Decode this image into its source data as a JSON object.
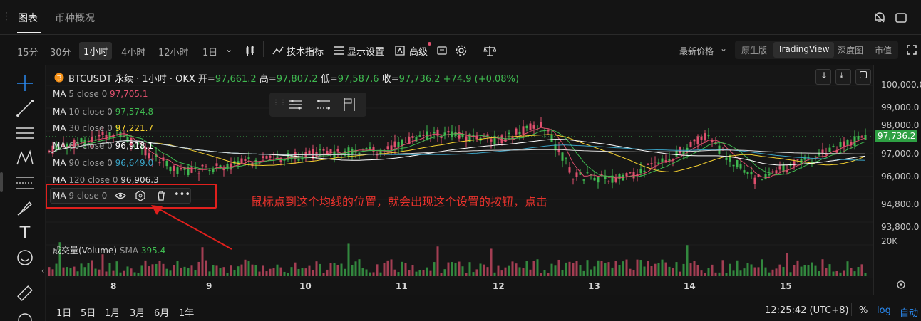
{
  "tabs": [
    {
      "label": "图表"
    },
    {
      "label": "币种概况"
    }
  ],
  "toolbar": {
    "timeframes": [
      "15分",
      "30分",
      "1小时",
      "4小时",
      "12小时",
      "1日"
    ],
    "active_timeframe": "1小时",
    "indicators_label": "技术指标",
    "display_label": "显示设置",
    "advanced_label": "高级",
    "price_type_label": "最新价格",
    "views": [
      "原生版",
      "TradingView",
      "深度图",
      "市值"
    ],
    "active_view": "TradingView"
  },
  "symbol": {
    "title": "BTCUSDT 永续 · 1小时 · OKX",
    "open_label": "开=",
    "open": "97,661.2",
    "high_label": "高=",
    "high": "97,807.2",
    "low_label": "低=",
    "low": "97,587.6",
    "close_label": "收=",
    "close": "97,736.2",
    "change": "+74.9 (+0.08%)"
  },
  "ma": [
    {
      "label": "MA",
      "params": "5 close 0",
      "value": "97,705.1",
      "color": "#e0506e"
    },
    {
      "label": "MA",
      "params": "10 close 0",
      "value": "97,574.8",
      "color": "#3fb950"
    },
    {
      "label": "MA",
      "params": "30 close 0",
      "value": "97,221.7",
      "color": "#f5d130"
    },
    {
      "label": "MA",
      "params": "60 close 0",
      "value": "96,918.1",
      "color": "#ffffff"
    },
    {
      "label": "MA",
      "params": "90 close 0",
      "value": "96,649.0",
      "color": "#3aa3c6"
    },
    {
      "label": "MA",
      "params": "120 close 0",
      "value": "96,906.3",
      "color": "#d8d8d8"
    }
  ],
  "ma9": {
    "label": "MA",
    "params": "9 close 0"
  },
  "annotation": "鼠标点到这个均线的位置，就会出现这个设置的按钮，点击",
  "volume": {
    "label": "成交量(Volume)",
    "sma_label": "SMA",
    "sma_value": "395.4",
    "axis_label": "20K"
  },
  "price_axis": [
    "100,000.0",
    "99,000.0",
    "98,000.0",
    "97,000.0",
    "96,000.0",
    "94,800.0",
    "93,800.0"
  ],
  "last_price": "97,736.2",
  "time_axis": [
    "8",
    "9",
    "10",
    "11",
    "12",
    "13",
    "14",
    "15"
  ],
  "ranges": [
    "1日",
    "5日",
    "1月",
    "3月",
    "6月",
    "1年"
  ],
  "clock": "12:25:42 (UTC+8)",
  "percent_label": "%",
  "log_label": "log",
  "auto_label": "自动",
  "colors": {
    "up": "#3fb950",
    "down": "#e0506e",
    "annotation": "#e0201d"
  }
}
